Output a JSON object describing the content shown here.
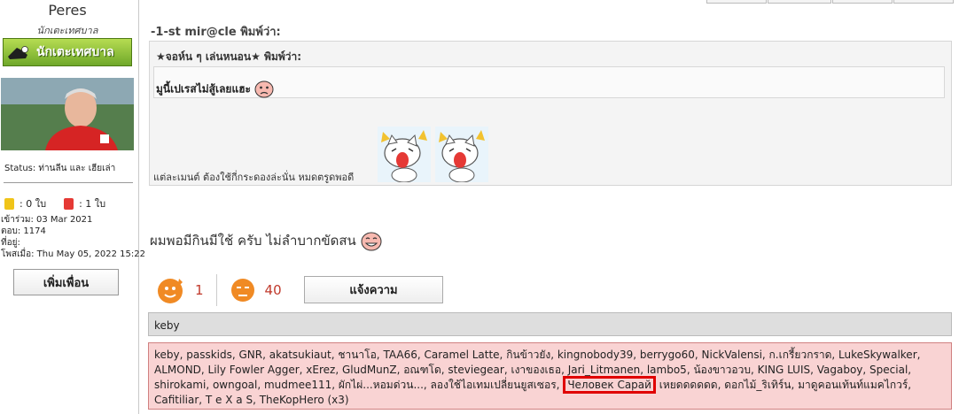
{
  "user": {
    "name": "Peres",
    "rank": "นักเตะเทศบาล",
    "rank_badge": "นักเตะเทศบาล",
    "status": "Status: ท่านลีน และ เฮียเล่า",
    "yellow_cards": ": 0 ใบ",
    "red_cards": ": 1 ใบ",
    "joined": "เข้าร่วม: 03 Mar 2021",
    "posts": "ตอบ: 1174",
    "location": "ที่อยู่:",
    "last_post": "โพสเมื่อ: Thu May 05, 2022 15:22",
    "add_friend": "เพิ่มเพื่อน"
  },
  "quote": {
    "outer_author": "-1-st mir@cle พิมพ์ว่า:",
    "inner_author": "★จอห์น ๆ เล่นหนอน★ พิมพ์ว่า:",
    "inner_text": "มูนี้เปเรสไม่สู้เลยแฮะ",
    "outer_text": "แต่ละเมนต์ ต้องใช้กี่กระดองล่ะนั่น หมดตรูดพอดี"
  },
  "post": {
    "message": "ผมพอมีกินมีใช้ ครับ ไม่ลำบากขัดสน"
  },
  "reactions": {
    "like_count": "1",
    "dislike_count": "40",
    "report_label": "แจ้งความ"
  },
  "likers": {
    "last_user": "keby",
    "before": "keby, passkids, GNR, akatsukiaut, ชานาโอ, TAA66, Caramel Latte, กินข้าวยัง, kingnobody39, berrygo60, NickValensi, ก.เกรี้ยวกราด, LukeSkywalker, ALMOND, Lily Fowler Agger, xErez, GludMunZ, อณฑโด, steviegear, เงาของเธอ, Jari_Litmanen, lambo5, น้องขาวอวบ, KING LUIS, Vagaboy, Special, shirokami, owngoal, mudmee111, ผักไผ่...หอมด่วน..., ลองใช้ไอเทมเปลี่ยนยูสเซอร, ",
    "highlighted": "Человек Сарай",
    "after": " เหยดดดดดด, ดอกไม้_ริเทิร์น, มาดูคอนเท้นท์แมคไกวร์, Cafitiliar, T e X a S, TheKopHero (x3)"
  },
  "colors": {
    "highlight_border": "#e00000",
    "likers_bg": "#f9d3d3",
    "count_color": "#c0392b"
  }
}
